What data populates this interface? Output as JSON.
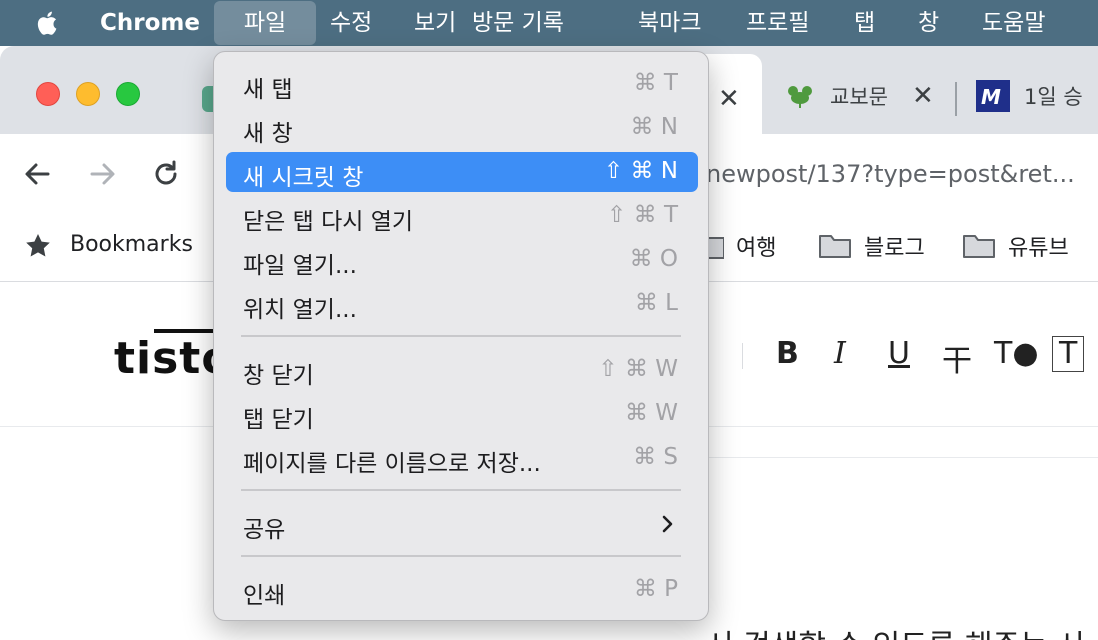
{
  "menubar": {
    "items": [
      {
        "label": "Chrome"
      },
      {
        "label": "파일"
      },
      {
        "label": "수정"
      },
      {
        "label": "보기"
      },
      {
        "label": "방문 기록"
      },
      {
        "label": "북마크"
      },
      {
        "label": "프로필"
      },
      {
        "label": "탭"
      },
      {
        "label": "창"
      },
      {
        "label": "도움말"
      }
    ]
  },
  "tabs": [
    {
      "title": "교보문"
    },
    {
      "title": "1일 승"
    }
  ],
  "toolbar": {
    "url_visible": "newpost/137?type=post&ret..."
  },
  "bookmarks": {
    "label": "Bookmarks",
    "folders": [
      {
        "label": "여행"
      },
      {
        "label": "블로그"
      },
      {
        "label": "유튜브"
      }
    ]
  },
  "page": {
    "logo": "tisto",
    "format_buttons": [
      "B",
      "I",
      "U",
      "干",
      "T●",
      "T"
    ],
    "body_text": "서 검색할 수 있도록 해주는 시"
  },
  "file_menu": {
    "items": [
      {
        "label": "새 탭",
        "shortcut": "⌘ T"
      },
      {
        "label": "새 창",
        "shortcut": "⌘ N"
      },
      {
        "label": "새 시크릿 창",
        "shortcut": "⇧ ⌘ N",
        "highlighted": true
      },
      {
        "label": "닫은 탭 다시 열기",
        "shortcut": "⇧ ⌘ T"
      },
      {
        "label": "파일 열기...",
        "shortcut": "⌘ O"
      },
      {
        "label": "위치 열기...",
        "shortcut": "⌘ L"
      },
      {
        "label": "창 닫기",
        "shortcut": "⇧ ⌘ W"
      },
      {
        "label": "탭 닫기",
        "shortcut": "⌘ W"
      },
      {
        "label": "페이지를 다른 이름으로 저장...",
        "shortcut": "⌘ S"
      },
      {
        "label": "공유",
        "shortcut": ""
      },
      {
        "label": "인쇄",
        "shortcut": "⌘ P"
      }
    ]
  },
  "colors": {
    "menubar_bg": "#4d6e82",
    "highlight": "#3d8ef6",
    "close_button": "#ff5f57",
    "minimize_button": "#febc2e",
    "maximize_button": "#28c840"
  }
}
